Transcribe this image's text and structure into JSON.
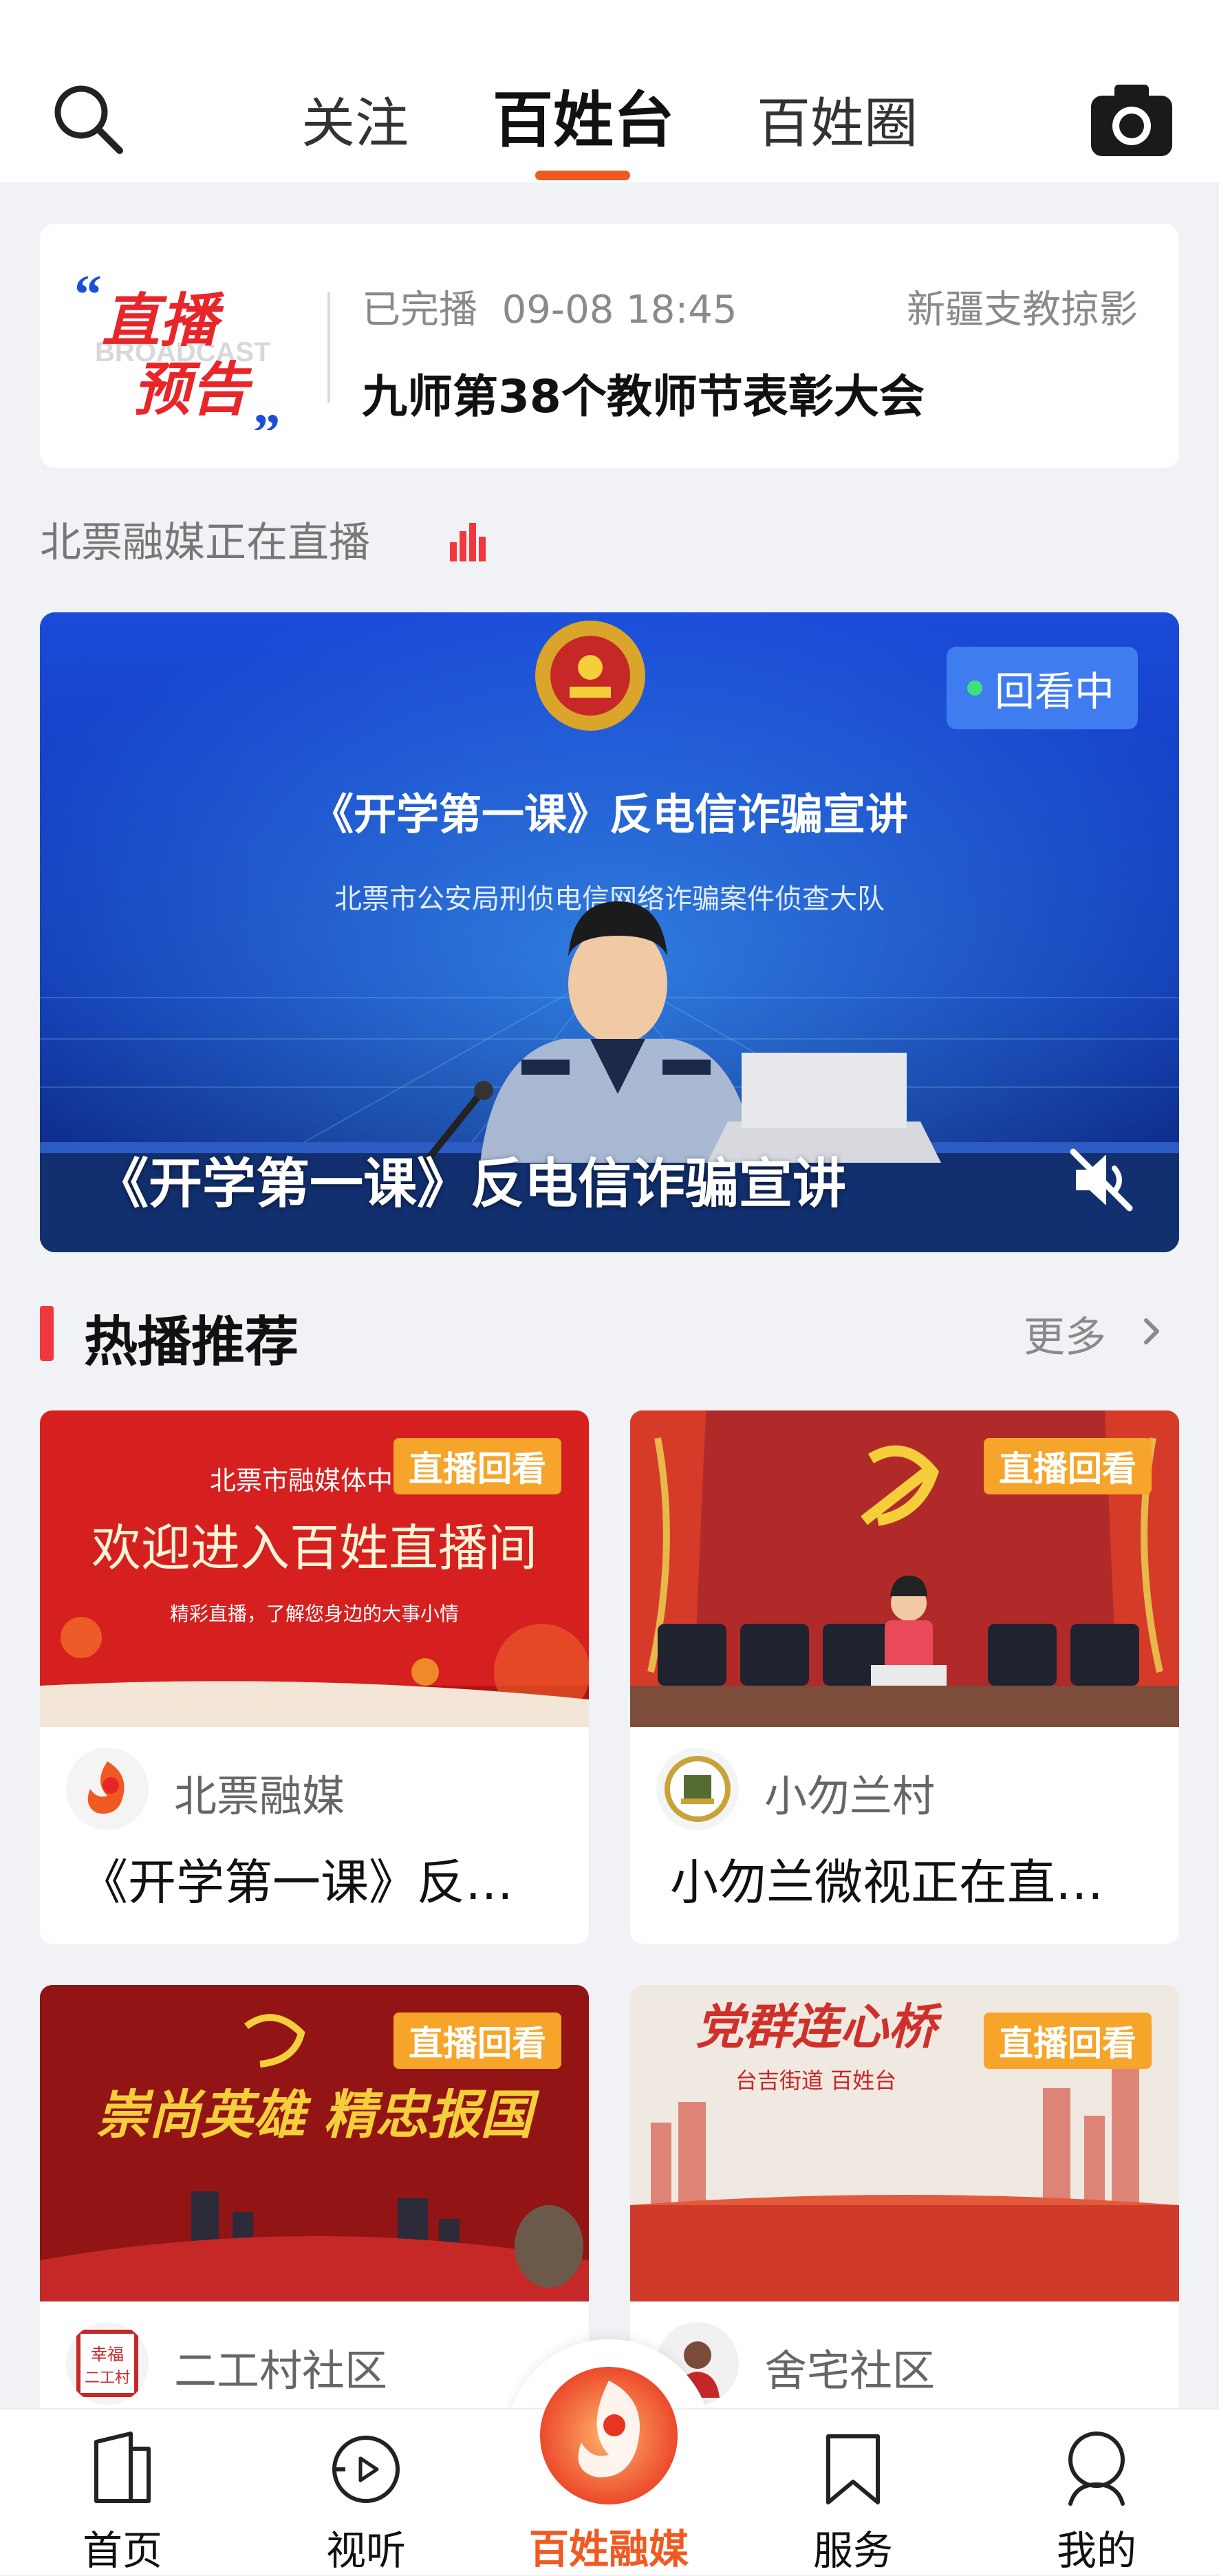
{
  "header": {
    "tabs": [
      {
        "label": "关注"
      },
      {
        "label": "百姓台"
      },
      {
        "label": "百姓圈"
      }
    ],
    "active_tab": "百姓台",
    "accent_color": "#f05a22"
  },
  "live_notice": {
    "logo_text_line1": "直播",
    "logo_text_line2": "预告",
    "logo_bg_text": "BROADCAST",
    "status": "已完播",
    "time": "09-08 18:45",
    "author": "新疆支教掠影",
    "title": "九师第38个教师节表彰大会"
  },
  "live_now": {
    "header": "北票融媒正在直播",
    "badge": "回看中",
    "banner_title": "《开学第一课》反电信诈骗宣讲",
    "banner_subtitle": "北票市公安局刑侦电信网络诈骗案件侦查大队",
    "caption": "《开学第一课》反电信诈骗宣讲"
  },
  "hot_section": {
    "title": "热播推荐",
    "more": "更多",
    "cards": [
      {
        "tag": "直播回看",
        "thumb_text1": "北票市融媒体中心",
        "thumb_text2": "欢迎进入百姓直播间",
        "thumb_text3": "精彩直播，了解您身边的大事小情",
        "source": "北票融媒",
        "title": "《开学第一课》反…"
      },
      {
        "tag": "直播回看",
        "source": "小勿兰村",
        "title": "小勿兰微视正在直…"
      },
      {
        "tag": "直播回看",
        "thumb_text1": "崇尚英雄 精忠报国",
        "source": "二工村社区",
        "avatar_text": "幸福二工村",
        "title": ""
      },
      {
        "tag": "直播回看",
        "thumb_text1": "党群连心桥",
        "thumb_text2": "台吉街道  百姓台",
        "source": "舍宅社区",
        "title": ""
      }
    ]
  },
  "bottom_nav": {
    "items": [
      {
        "label": "首页"
      },
      {
        "label": "视听"
      },
      {
        "label": "百姓融媒"
      },
      {
        "label": "服务"
      },
      {
        "label": "我的"
      }
    ]
  }
}
